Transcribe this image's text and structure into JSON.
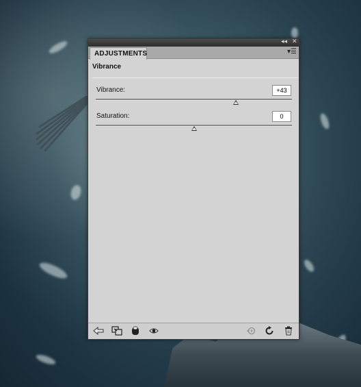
{
  "panel": {
    "tab_label": "ADJUSTMENTS",
    "title": "Vibrance",
    "controls": [
      {
        "label": "Vibrance:",
        "value": "+43",
        "position": 0.715
      },
      {
        "label": "Saturation:",
        "value": "0",
        "position": 0.5
      }
    ]
  },
  "icons": {
    "collapse": "double-chevron-left-icon",
    "close": "close-icon",
    "panel_menu": "panel-menu-icon",
    "bottom_left": [
      "back-arrow-icon",
      "clip-to-layer-icon",
      "layer-mask-icon",
      "visibility-eye-icon"
    ],
    "bottom_right": [
      "previous-state-icon",
      "reset-icon",
      "trash-icon"
    ]
  },
  "colors": {
    "panel_bg": "#d3d3d3",
    "thumb_fill": "#eaeaea"
  }
}
